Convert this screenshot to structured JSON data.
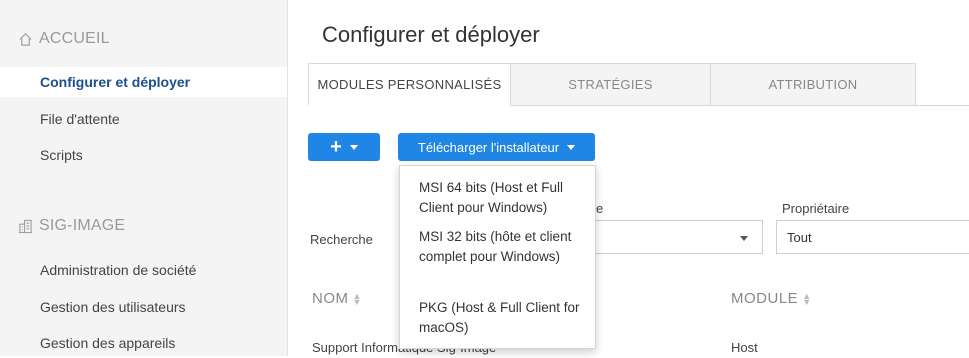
{
  "sidebar": {
    "sections": [
      {
        "label": "ACCUEIL",
        "icon": "home-icon"
      },
      {
        "label": "SIG-IMAGE",
        "icon": "building-icon"
      }
    ],
    "items": [
      {
        "label": "Configurer et déployer",
        "active": true
      },
      {
        "label": "File d'attente"
      },
      {
        "label": "Scripts"
      },
      {
        "label": "Administration de société"
      },
      {
        "label": "Gestion des utilisateurs"
      },
      {
        "label": "Gestion des appareils"
      }
    ]
  },
  "main": {
    "title": "Configurer et déployer",
    "tabs": [
      {
        "label": "MODULES PERSONNALISÉS",
        "active": true
      },
      {
        "label": "STRATÉGIES"
      },
      {
        "label": "ATTRIBUTION"
      }
    ],
    "add_button_label": "+",
    "download_button_label": "Télécharger l'installateur",
    "download_menu": [
      "MSI 64 bits (Host et Full Client pour Windows)",
      "MSI 32 bits (hôte et client complet pour Windows)",
      "PKG (Host & Full Client for macOS)"
    ],
    "filters": {
      "search_label": "Recherche",
      "type_label_fragment": "e",
      "owner_label": "Propriétaire",
      "owner_value": "Tout"
    },
    "table": {
      "columns": [
        "NOM",
        "MODULE"
      ],
      "rows": [
        {
          "name": "Support Informatique Sig-Image",
          "module": "Host"
        }
      ]
    }
  },
  "colors": {
    "accent": "#1f86e6",
    "active_nav": "#1c4f8f"
  }
}
